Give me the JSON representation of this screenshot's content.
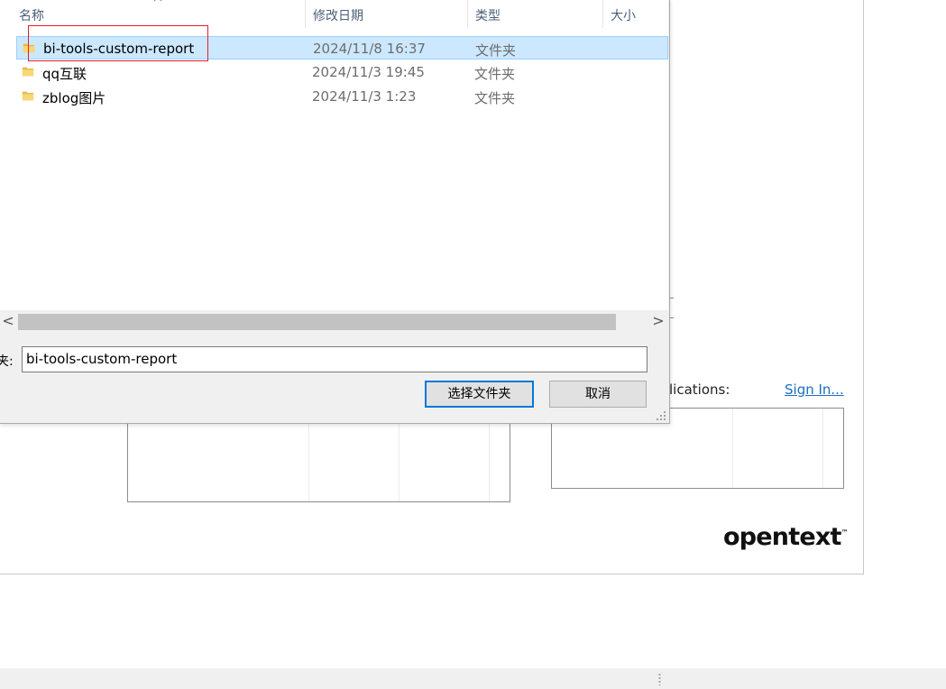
{
  "background": {
    "apps_label": "lications:",
    "signin_link": "Sign In...",
    "logo": {
      "text": "opentext",
      "tm": "™"
    }
  },
  "dialog": {
    "columns": {
      "name": "名称",
      "modified": "修改日期",
      "type": "类型",
      "size": "大小"
    },
    "files": [
      {
        "name": "bi-tools-custom-report",
        "modified": "2024/11/8 16:37",
        "type": "文件夹",
        "selected": true
      },
      {
        "name": "qq互联",
        "modified": "2024/11/3 19:45",
        "type": "文件夹",
        "selected": false
      },
      {
        "name": "zblog图片",
        "modified": "2024/11/3 1:23",
        "type": "文件夹",
        "selected": false
      }
    ],
    "scroll_left": "<",
    "scroll_right": ">",
    "folder_label": "夹:",
    "folder_value": "bi-tools-custom-report",
    "select_button": "选择文件夹",
    "cancel_button": "取消"
  },
  "colors": {
    "selection_bg": "#cce8ff",
    "selection_border": "#99d1ff",
    "highlight_box": "#e0202a",
    "primary_button_border": "#0078d7",
    "link": "#1a6fc4",
    "folder_yellow": "#f8d775"
  },
  "icons": {
    "folder": "folder-icon",
    "sort": "sort-up-icon",
    "grip": "resize-grip-icon"
  }
}
